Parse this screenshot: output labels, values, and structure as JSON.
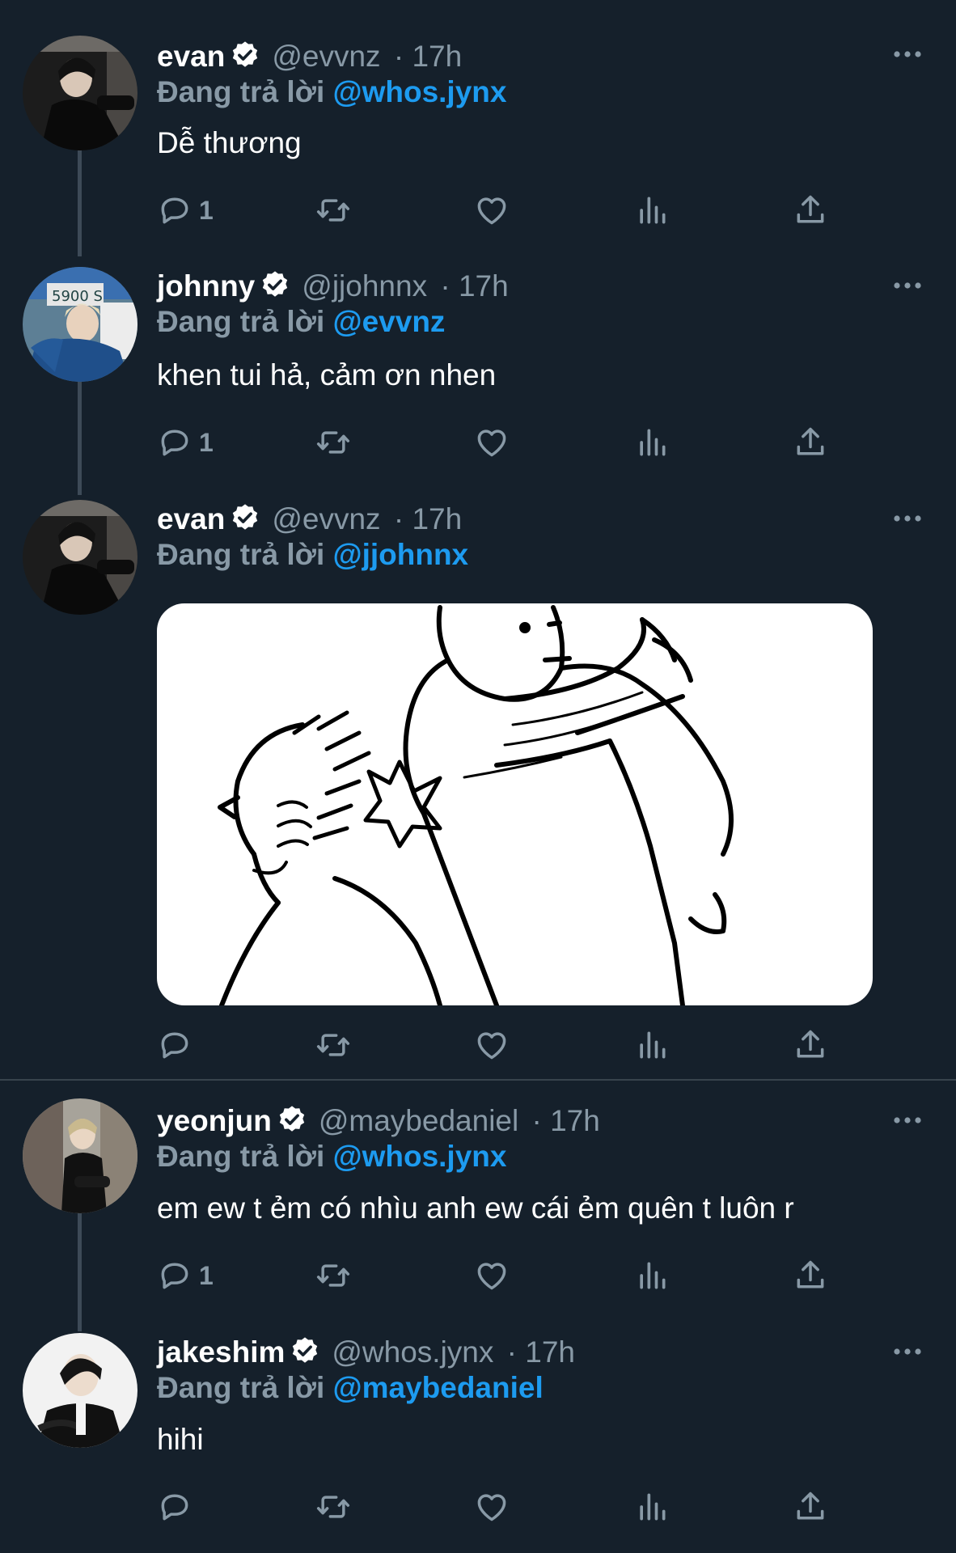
{
  "ui": {
    "reply_prefix": "Đang trả lời",
    "accent": "#1d9bf0",
    "muted": "#8899a6",
    "background": "#15202b"
  },
  "tweets": [
    {
      "name": "evan",
      "handle": "@evvnz",
      "time": "· 17h",
      "reply_to": "@whos.jynx",
      "text": "Dễ thương",
      "reply_count": "1"
    },
    {
      "name": "johnny",
      "handle": "@jjohnnx",
      "time": "· 17h",
      "reply_to": "@evvnz",
      "text": "khen tui hả, cảm ơn nhen",
      "reply_count": "1"
    },
    {
      "name": "evan",
      "handle": "@evvnz",
      "time": "· 17h",
      "reply_to": "@jjohnnx",
      "text": "",
      "reply_count": "",
      "media": "comic-slap-image"
    },
    {
      "name": "yeonjun",
      "handle": "@maybedaniel",
      "time": "· 17h",
      "reply_to": "@whos.jynx",
      "text": "em ew t ẻm có nhìu anh ew cái ẻm quên t luôn r",
      "reply_count": "1"
    },
    {
      "name": "jakeshim",
      "handle": "@whos.jynx",
      "time": "· 17h",
      "reply_to": "@maybedaniel",
      "text": "hihi",
      "reply_count": ""
    }
  ],
  "icons": {
    "reply": "reply-icon",
    "retweet": "retweet-icon",
    "like": "heart-icon",
    "views": "views-icon",
    "share": "share-icon",
    "more": "more-icon",
    "verified": "verified-badge-icon"
  }
}
